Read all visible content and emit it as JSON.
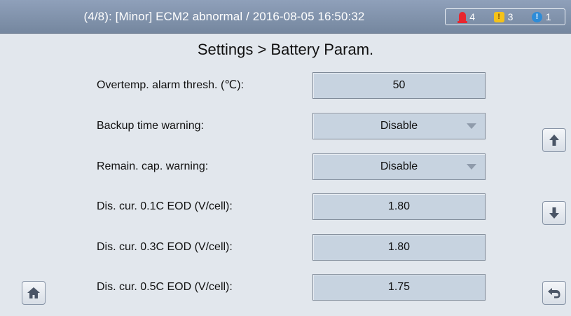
{
  "alarm_bar": {
    "message": "(4/8): [Minor] ECM2 abnormal / 2016-08-05 16:50:32",
    "critical_count": "4",
    "major_count": "3",
    "major_symbol": "!",
    "minor_count": "1",
    "minor_symbol": "!"
  },
  "page": {
    "title": "Settings > Battery Param."
  },
  "params": [
    {
      "label": "Overtemp. alarm thresh. (℃):",
      "value": "50",
      "type": "input"
    },
    {
      "label": "Backup time warning:",
      "value": "Disable",
      "type": "select"
    },
    {
      "label": "Remain. cap. warning:",
      "value": "Disable",
      "type": "select"
    },
    {
      "label": "Dis. cur. 0.1C EOD (V/cell):",
      "value": "1.80",
      "type": "input"
    },
    {
      "label": "Dis. cur. 0.3C EOD (V/cell):",
      "value": "1.80",
      "type": "input"
    },
    {
      "label": "Dis. cur. 0.5C EOD (V/cell):",
      "value": "1.75",
      "type": "input"
    }
  ],
  "icons": {
    "critical": "critical-alarm-icon",
    "major": "major-alarm-icon",
    "minor": "minor-alarm-icon",
    "up": "arrow-up-icon",
    "down": "arrow-down-icon",
    "home": "home-icon",
    "back": "back-icon"
  },
  "colors": {
    "topbar": "#7f91aa",
    "background": "#e2e7ed",
    "field": "#c7d3e0",
    "critical": "#e8262e",
    "major": "#f4c219",
    "minor": "#2e8cd8"
  }
}
